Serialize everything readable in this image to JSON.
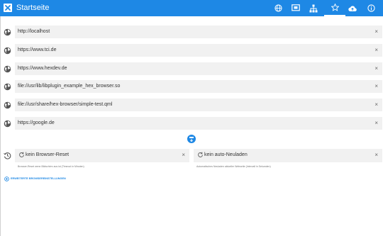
{
  "header": {
    "title": "Startseite",
    "accent": "#1e88e5",
    "toolbar": [
      {
        "icon": "globe-icon"
      },
      {
        "icon": "display-icon"
      },
      {
        "icon": "sitemap-icon"
      },
      {
        "icon": "star-icon",
        "active": true
      },
      {
        "icon": "cloud-upload-icon"
      },
      {
        "icon": "info-icon"
      }
    ]
  },
  "urls": [
    {
      "value": "http://localhost",
      "clear": "×"
    },
    {
      "value": "https://www.tci.de",
      "clear": "×"
    },
    {
      "value": "https://www.hexdev.de",
      "clear": "×"
    },
    {
      "value": "file://usr/lib/libplugin_example_hex_browser.so",
      "clear": "×"
    },
    {
      "value": "file://usr/share/hex-browser/simple-test.qml",
      "clear": "×"
    },
    {
      "value": "https://google.de",
      "clear": "×"
    }
  ],
  "reset": {
    "browser_reset": {
      "value": "kein Browser-Reset",
      "clear": "×",
      "hint": "Browser-Reset wenn Bildschirm aus ist (Timeout in Minuten)"
    },
    "auto_reload": {
      "value": "kein auto-Neuladen",
      "clear": "×",
      "hint": "Automatisches Neuladen aktueller Webseite (Intervall in Sekunden)"
    }
  },
  "advanced_link": "ERWEITERTE BROWSEREINSTELLUNGEN"
}
